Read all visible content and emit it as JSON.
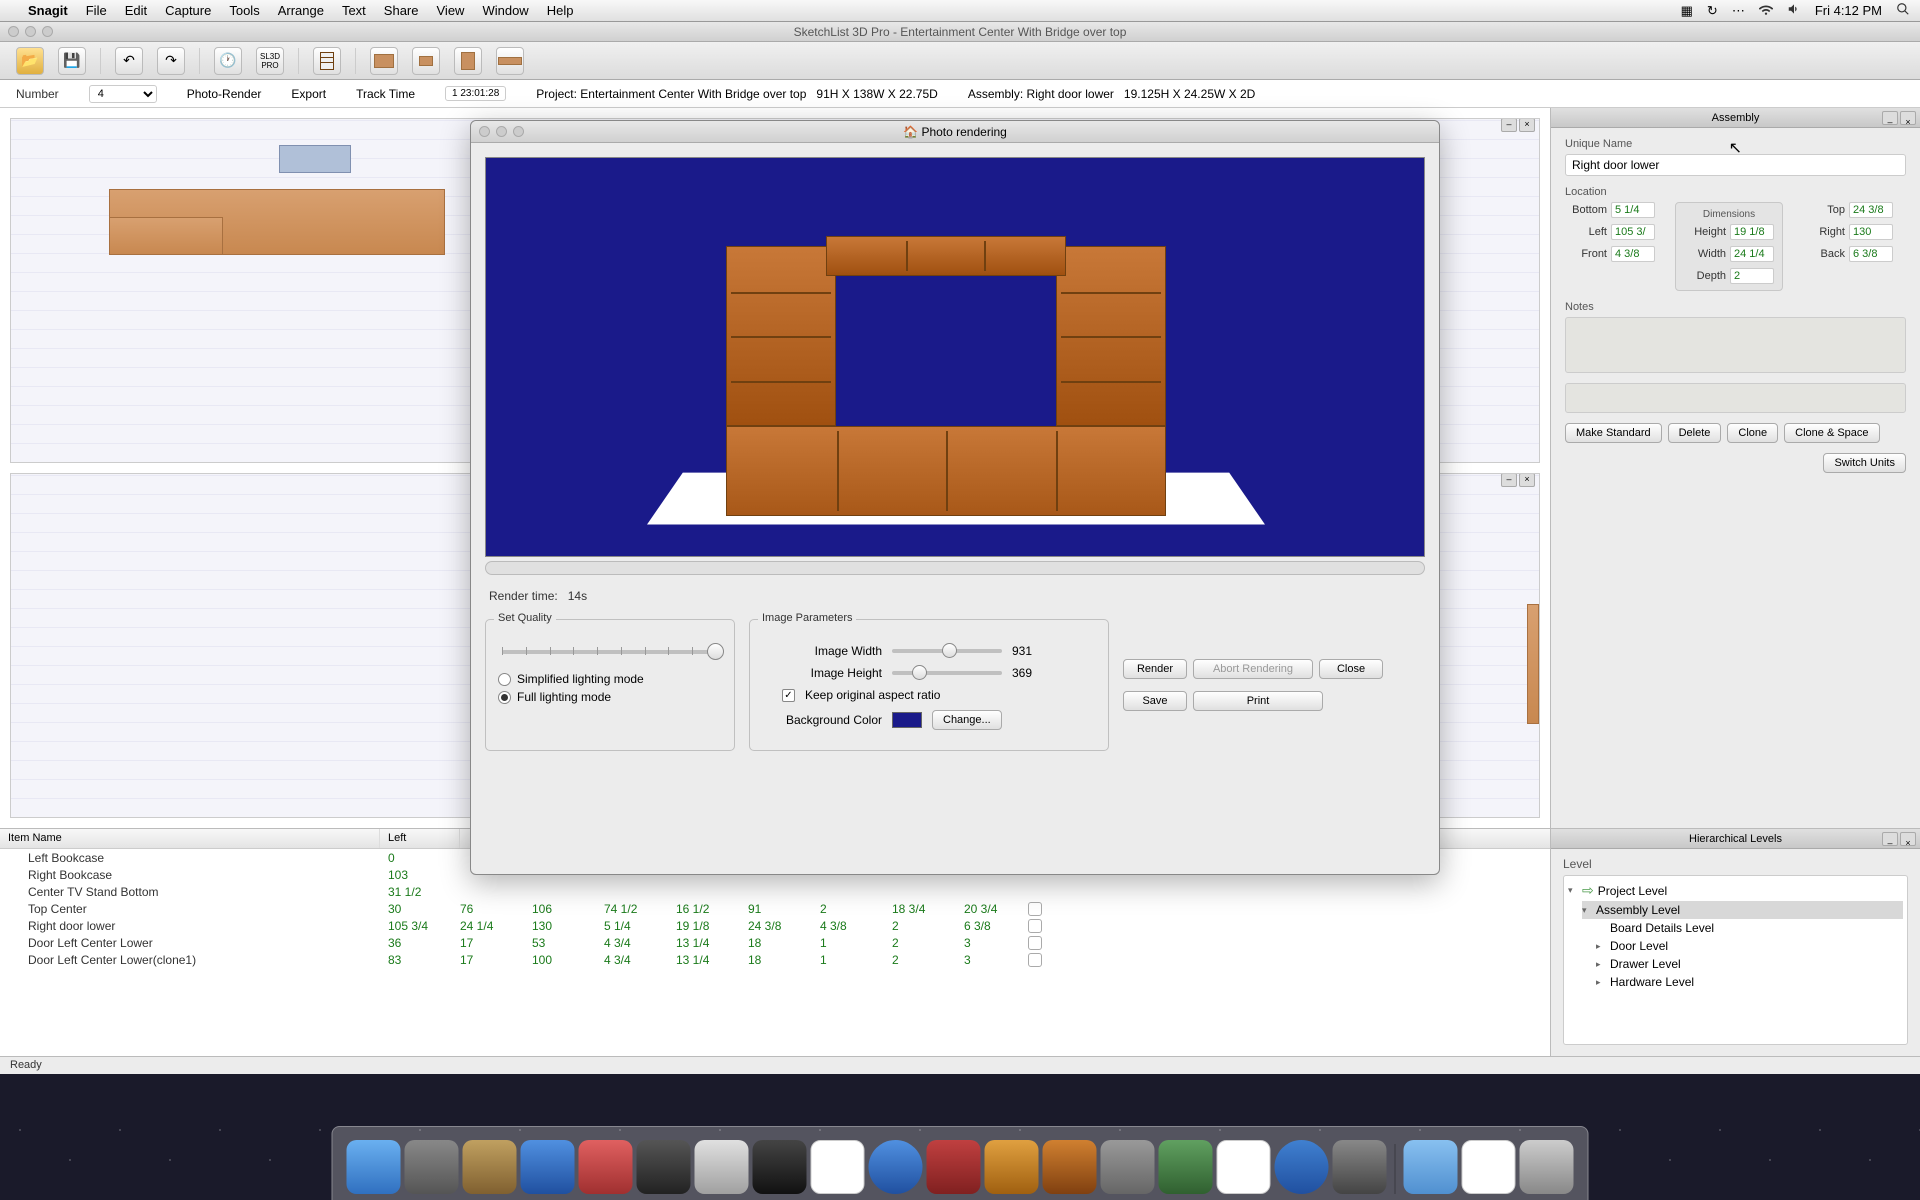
{
  "menubar": {
    "apple": "",
    "appname": "Snagit",
    "items": [
      "File",
      "Edit",
      "Capture",
      "Tools",
      "Arrange",
      "Text",
      "Share",
      "View",
      "Window",
      "Help"
    ],
    "clock": "Fri 4:12 PM"
  },
  "window": {
    "title": "SketchList 3D Pro - Entertainment Center With Bridge over top"
  },
  "infobar": {
    "number_label": "Number",
    "number_value": "4",
    "photo_render": "Photo-Render",
    "export": "Export",
    "track_time_label": "Track Time",
    "track_time_value": "1 23:01:28",
    "project_label": "Project:",
    "project_name": "Entertainment Center With Bridge over top",
    "project_dims": "91H X 138W X 22.75D",
    "assembly_label": "Assembly:",
    "assembly_name": "Right door lower",
    "assembly_dims": "19.125H X 24.25W X 2D"
  },
  "assembly_panel": {
    "title": "Assembly",
    "unique_name_label": "Unique Name",
    "unique_name_value": "Right door lower",
    "location_label": "Location",
    "dimensions_label": "Dimensions",
    "bottom_label": "Bottom",
    "bottom_val": "5 1/4",
    "left_label": "Left",
    "left_val": "105 3/",
    "front_label": "Front",
    "front_val": "4 3/8",
    "height_label": "Height",
    "height_val": "19 1/8",
    "width_label": "Width",
    "width_val": "24 1/4",
    "depth_label": "Depth",
    "depth_val": "2",
    "top_label": "Top",
    "top_val": "24 3/8",
    "right_label": "Right",
    "right_val": "130",
    "back_label": "Back",
    "back_val": "6 3/8",
    "notes_label": "Notes",
    "make_standard": "Make Standard",
    "delete": "Delete",
    "clone": "Clone",
    "clone_space": "Clone & Space",
    "switch_units": "Switch Units"
  },
  "items_table": {
    "headers": [
      "Item Name",
      "Left"
    ],
    "rows": [
      {
        "name": "Left Bookcase",
        "vals": [
          "0"
        ]
      },
      {
        "name": "Right Bookcase",
        "vals": [
          "103"
        ]
      },
      {
        "name": "Center TV Stand Bottom",
        "vals": [
          "31 1/2"
        ]
      },
      {
        "name": "Top Center",
        "vals": [
          "30",
          "76",
          "106",
          "74 1/2",
          "16 1/2",
          "91",
          "2",
          "18 3/4",
          "20 3/4"
        ]
      },
      {
        "name": "Right door lower",
        "vals": [
          "105 3/4",
          "24 1/4",
          "130",
          "5 1/4",
          "19 1/8",
          "24 3/8",
          "4 3/8",
          "2",
          "6 3/8"
        ]
      },
      {
        "name": "Door Left Center Lower",
        "vals": [
          "36",
          "17",
          "53",
          "4 3/4",
          "13 1/4",
          "18",
          "1",
          "2",
          "3"
        ]
      },
      {
        "name": "Door Left Center Lower(clone1)",
        "vals": [
          "83",
          "17",
          "100",
          "4 3/4",
          "13 1/4",
          "18",
          "1",
          "2",
          "3"
        ]
      }
    ]
  },
  "hier_panel": {
    "title": "Hierarchical Levels",
    "level_label": "Level",
    "items": [
      {
        "label": "Project Level",
        "indent": 0,
        "arrow": "▾",
        "icon": "green"
      },
      {
        "label": "Assembly Level",
        "indent": 1,
        "arrow": "▾",
        "selected": true
      },
      {
        "label": "Board Details Level",
        "indent": 2,
        "arrow": ""
      },
      {
        "label": "Door Level",
        "indent": 2,
        "arrow": "▸"
      },
      {
        "label": "Drawer Level",
        "indent": 2,
        "arrow": "▸"
      },
      {
        "label": "Hardware Level",
        "indent": 2,
        "arrow": "▸"
      }
    ]
  },
  "status": "Ready",
  "dialog": {
    "title": "Photo rendering",
    "render_time_label": "Render time:",
    "render_time_value": "14s",
    "quality_label": "Set Quality",
    "simplified": "Simplified lighting mode",
    "full": "Full lighting mode",
    "params_label": "Image Parameters",
    "img_width_label": "Image Width",
    "img_width_val": "931",
    "img_height_label": "Image Height",
    "img_height_val": "369",
    "keep_aspect": "Keep original aspect ratio",
    "bg_color_label": "Background Color",
    "bg_color": "#1a1a8a",
    "change_btn": "Change...",
    "render_btn": "Render",
    "abort_btn": "Abort Rendering",
    "close_btn": "Close",
    "save_btn": "Save",
    "print_btn": "Print"
  }
}
